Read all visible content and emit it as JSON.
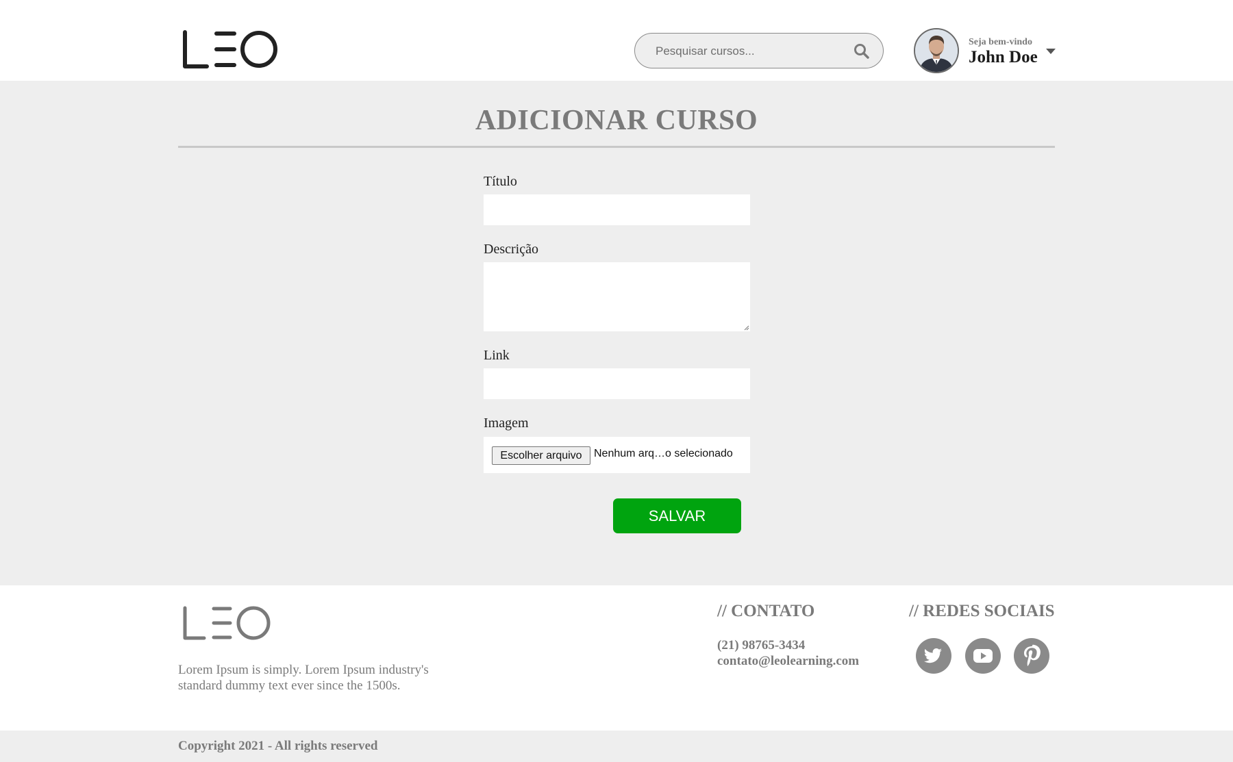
{
  "header": {
    "logo_text": "LEO",
    "search": {
      "placeholder": "Pesquisar cursos..."
    },
    "user": {
      "welcome": "Seja bem-vindo",
      "name": "John Doe"
    }
  },
  "main": {
    "title": "ADICIONAR CURSO",
    "form": {
      "titulo_label": "Título",
      "titulo_value": "",
      "descricao_label": "Descrição",
      "descricao_value": "",
      "link_label": "Link",
      "link_value": "",
      "imagem_label": "Imagem",
      "file_button": "Escolher arquivo",
      "file_status": "Nenhum arq…o selecionado",
      "save_button": "SALVAR"
    }
  },
  "footer": {
    "logo_text": "LEO",
    "description": "Lorem Ipsum is simply. Lorem Ipsum industry's standard dummy text ever since the 1500s.",
    "contact_heading": "// CONTATO",
    "phone": "(21) 98765-3434",
    "email": "contato@leolearning.com",
    "social_heading": "// REDES SOCIAIS",
    "social_icons": [
      "twitter-icon",
      "youtube-icon",
      "pinterest-icon"
    ],
    "copyright": "Copyright 2021 - All rights reserved"
  },
  "colors": {
    "accent_green": "#00a40f",
    "page_bg": "#eeeeee",
    "muted_text": "#7a7a7a"
  }
}
